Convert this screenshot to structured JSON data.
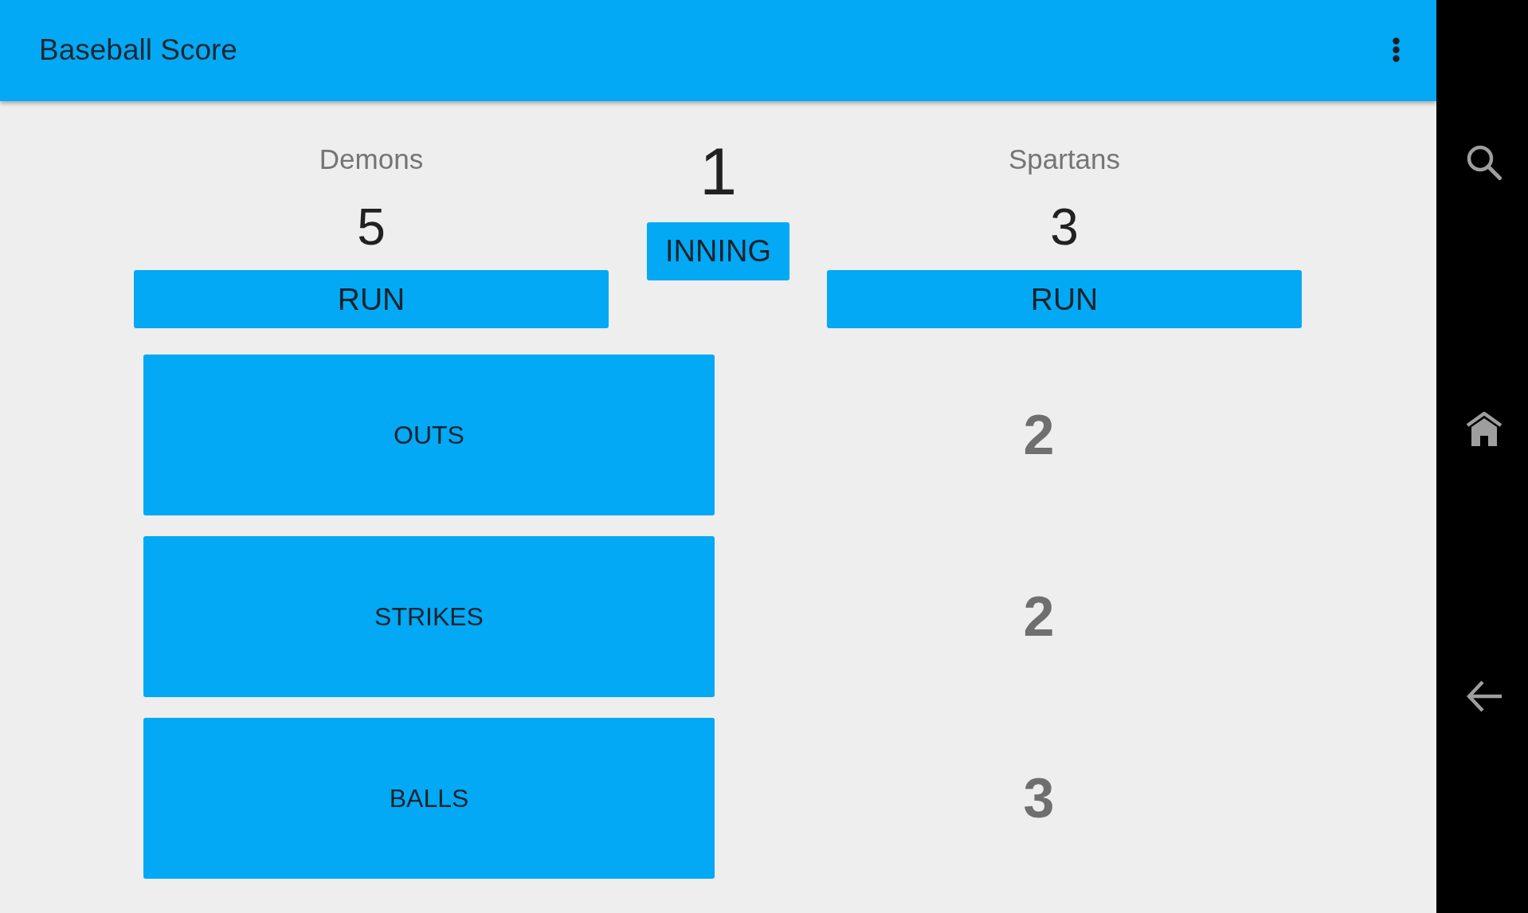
{
  "app_bar": {
    "title": "Baseball Score"
  },
  "teams": [
    {
      "name": "Demons",
      "score": "5",
      "button": "RUN"
    },
    {
      "name": "Spartans",
      "score": "3",
      "button": "RUN"
    }
  ],
  "inning": {
    "number": "1",
    "button": "INNING"
  },
  "counters": [
    {
      "button": "OUTS",
      "count": "2"
    },
    {
      "button": "STRIKES",
      "count": "2"
    },
    {
      "button": "BALLS",
      "count": "3"
    }
  ]
}
